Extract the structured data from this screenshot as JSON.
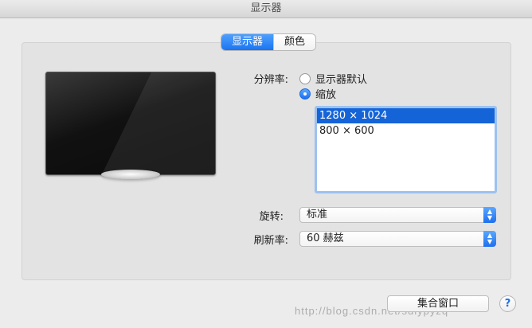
{
  "window": {
    "title": "显示器"
  },
  "tabs": [
    {
      "label": "显示器",
      "active": true
    },
    {
      "label": "颜色",
      "active": false
    }
  ],
  "resolution": {
    "label": "分辨率:",
    "options": [
      {
        "label": "显示器默认",
        "checked": false
      },
      {
        "label": "缩放",
        "checked": true
      }
    ],
    "list": [
      "1280 × 1024",
      "800 × 600"
    ],
    "selected_index": 0
  },
  "rotation": {
    "label": "旋转:",
    "value": "标准"
  },
  "refresh": {
    "label": "刷新率:",
    "value": "60 赫兹"
  },
  "gather_button": {
    "label": "集合窗口"
  },
  "help_button": {
    "label": "?"
  },
  "watermark": "http://blog.csdn.net/sdlypyzq",
  "colors": {
    "accent": "#1a74f0",
    "selection": "#1464d8"
  }
}
